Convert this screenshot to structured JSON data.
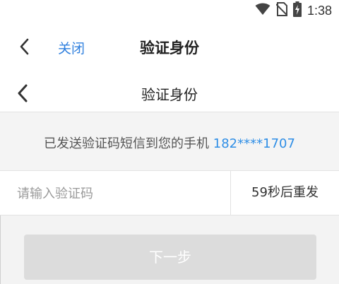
{
  "status_bar": {
    "time": "1:38",
    "icons": [
      "wifi-icon",
      "no-sim-icon",
      "battery-charging-icon"
    ]
  },
  "outer_nav": {
    "back_icon": "chevron-left-icon",
    "close_label": "关闭",
    "title": "验证身份"
  },
  "inner_nav": {
    "back_icon": "chevron-left-icon",
    "title": "验证身份"
  },
  "info": {
    "prefix": "已发送验证码短信到您的手机",
    "phone": "182****1707"
  },
  "code_entry": {
    "value": "",
    "placeholder": "请输入验证码",
    "resend_label": "59秒后重发"
  },
  "next_button": {
    "label": "下一步"
  },
  "colors": {
    "accent": "#2e8ee6",
    "close_link": "#2e7fde",
    "disabled_button": "#dcdcdc"
  }
}
